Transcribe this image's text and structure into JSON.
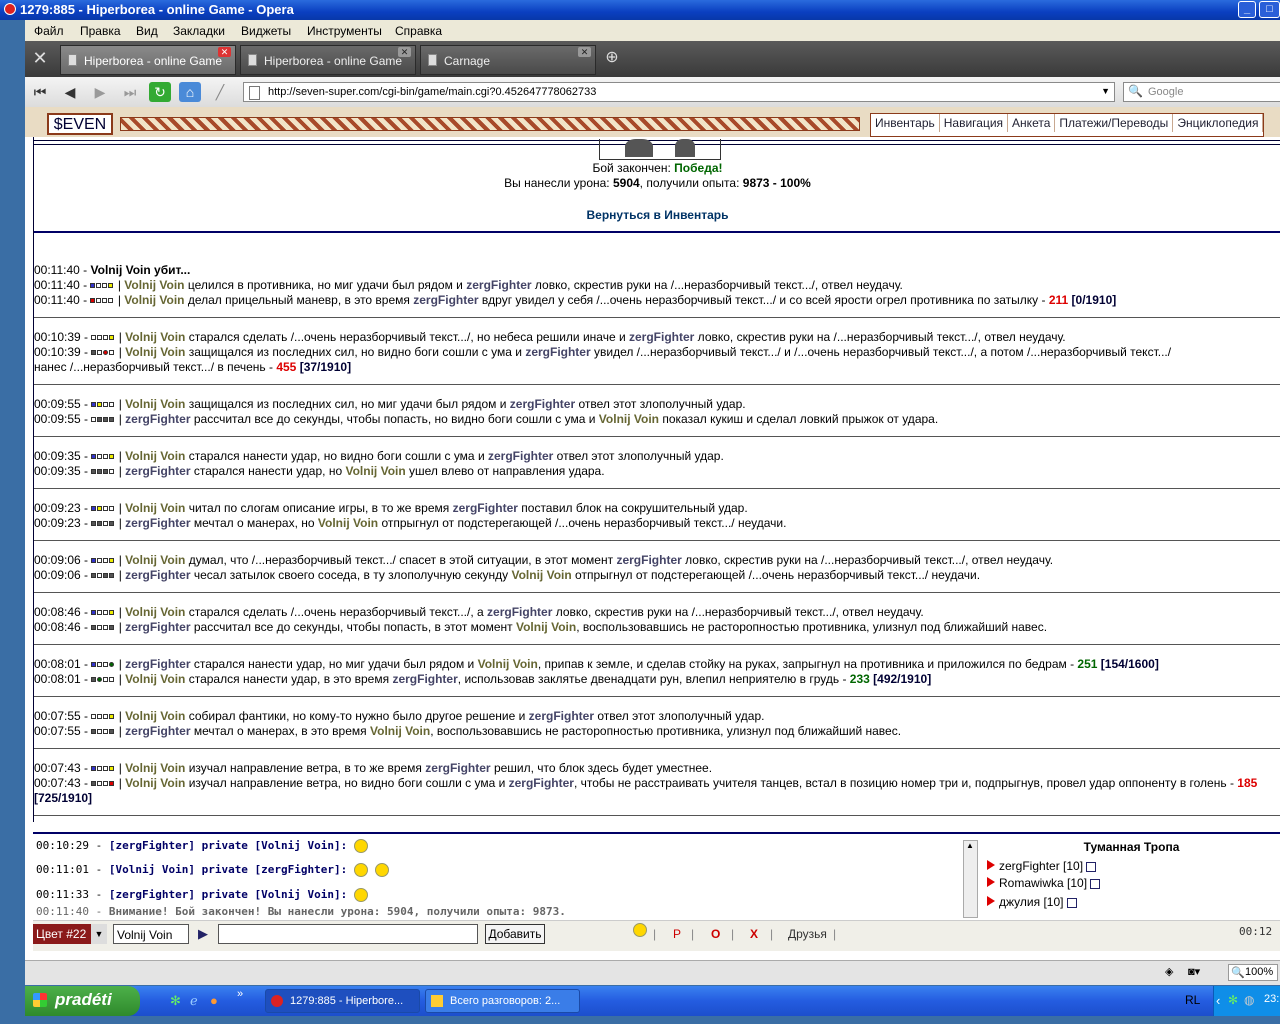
{
  "window": {
    "title": "1279:885 - Hiperborea - online Game - Opera"
  },
  "menu": [
    "Файл",
    "Правка",
    "Вид",
    "Закладки",
    "Виджеты",
    "Инструменты",
    "Справка"
  ],
  "tabs": [
    {
      "label": "Hiperborea - online Game",
      "active": true
    },
    {
      "label": "Hiperborea - online Game",
      "active": false
    },
    {
      "label": "Carnage",
      "active": false
    }
  ],
  "address": {
    "url": "http://seven-super.com/cgi-bin/game/main.cgi?0.452647778062733",
    "search_placeholder": "Google"
  },
  "game": {
    "logo": "$EVEN",
    "nav": [
      "Инвентарь",
      "Навигация",
      "Анкета",
      "Платежи/Переводы",
      "Энциклопедия"
    ],
    "battle_over_label": "Бой закончен:",
    "victory": "Победа!",
    "summary_prefix": "Вы нанесли урона:",
    "damage": "5904",
    "summary_mid": ", получили опыта:",
    "exp": "9873 - 100%",
    "return_link": "Вернуться в Инвентарь"
  },
  "log": {
    "killed_time": "00:11:40 -",
    "killed_text": "Volnij Voin убит...",
    "lines": [
      "00:11:40 - ",
      "00:11:40 - ",
      "00:10:39 - ",
      "00:10:39 - ",
      "нанес /...неразборчивый текст.../ в печень",
      "00:09:55 - ",
      "00:09:55 - ",
      "00:09:35 - ",
      "00:09:35 - ",
      "00:09:23 - ",
      "00:09:23 - ",
      "00:09:06 - ",
      "00:09:06 - ",
      "00:08:46 - ",
      "00:08:46 - ",
      "00:08:01 - ",
      "00:08:01 - ",
      "00:07:55 - ",
      "00:07:55 - ",
      "00:07:43 - ",
      "00:07:43 - ",
      "[725/1910]"
    ],
    "texts": [
      " целился в противника, но миг удачи был рядом и ",
      " ловко, скрестив руки на /...неразборчивый текст.../, отвел неудачу.",
      " делал прицельный маневр, в это время ",
      " вдруг увидел у себя /...очень неразборчивый текст.../ и со всей ярости огрел противника по затылку - ",
      " старался сделать /...очень неразборчивый текст.../, но небеса решили иначе и ",
      " ловко, скрестив руки на /...неразборчивый текст.../, отвел неудачу.",
      " защищался из последних сил, но видно боги сошли с ума и ",
      " увидел /...неразборчивый текст.../ и /...очень неразборчивый текст.../, а потом /...неразборчивый текст.../",
      " защищался из последних сил, но миг удачи был рядом и ",
      " отвел этот злополучный удар.",
      " рассчитал все до секунды, чтобы попасть, но видно боги сошли с ума и ",
      " показал кукиш и сделал ловкий прыжок от удара.",
      " старался нанести удар, но видно боги сошли с ума и ",
      " отвел этот злополучный удар.",
      " старался нанести удар, но ",
      " ушел влево от направления удара.",
      " читал по слогам описание игры, в то же время ",
      " поставил блок на сокрушительный удар.",
      " мечтал о манерах, но ",
      " отпрыгнул от подстерегающей /...очень неразборчивый текст.../ неудачи.",
      " думал, что /...неразборчивый текст.../ спасет в этой ситуации, в этот момент ",
      " ловко, скрестив руки на /...неразборчивый текст.../, отвел неудачу.",
      " чесал затылок своего соседа, в ту злополучную секунду ",
      " отпрыгнул от подстерегающей /...очень неразборчивый текст.../ неудачи.",
      " старался сделать /...очень неразборчивый текст.../, а ",
      " ловко, скрестив руки на /...неразборчивый текст.../, отвел неудачу.",
      " рассчитал все до секунды, чтобы попасть, в этот момент ",
      ", воспользовавшись не расторопностью противника, улизнул под ближайший навес.",
      " старался нанести удар, но миг удачи был рядом и ",
      ", припав к земле, и сделав стойку на руках, запрыгнул на противника и приложился по бедрам - ",
      " старался нанести удар, в это время ",
      ", использовав заклятье двенадцати рун, влепил неприятелю в грудь - ",
      " собирал фантики, но кому-то нужно было другое решение и ",
      " отвел этот злополучный удар.",
      " мечтал о манерах, в это время ",
      ", воспользовавшись не расторопностью противника, улизнул под ближайший навес.",
      " изучал направление ветра, в то же время ",
      " решил, что блок здесь будет уместнее.",
      " изучал направление ветра, но видно боги сошли с ума и ",
      ", чтобы не расстраивать учителя танцев, встал в позицию номер три и, подпрыгнув, провел удар оппоненту в голень - "
    ],
    "p1": "Volnij Voin",
    "p2": "zergFighter",
    "dmg": [
      "211",
      "455",
      "251",
      "233",
      "185"
    ],
    "hp": [
      "[0/1910]",
      "[37/1910]",
      "[154/1600]",
      "[492/1910]"
    ]
  },
  "chat": {
    "messages": [
      {
        "time": "00:10:29 -",
        "text": "[zergFighter] private [Volnij Voin]:"
      },
      {
        "time": "00:11:01 -",
        "text": "[Volnij Voin] private [zergFighter]:"
      },
      {
        "time": "00:11:33 -",
        "text": "[zergFighter] private [Volnij Voin]:"
      },
      {
        "time": "00:11:40 -",
        "text": "Внимание! Бой закончен! Вы нанесли урона: 5904, получили опыта: 9873."
      }
    ],
    "location": "Туманная Тропа",
    "users": [
      "zergFighter [10]",
      "Romawiwka [10]",
      "джулия [10]"
    ],
    "color_select": "Цвет #22",
    "nick": "Volnij Voin",
    "add_button": "Добавить",
    "buttons": [
      "Р",
      "О",
      "Х"
    ],
    "friends": "Друзья",
    "clock": "00:12"
  },
  "status": {
    "zoom": "100%"
  },
  "taskbar": {
    "start": "pradéti",
    "tasks": [
      "1279:885 - Hiperbore...",
      "Всего разговоров: 2..."
    ],
    "lang": "RL",
    "time": "23:"
  }
}
